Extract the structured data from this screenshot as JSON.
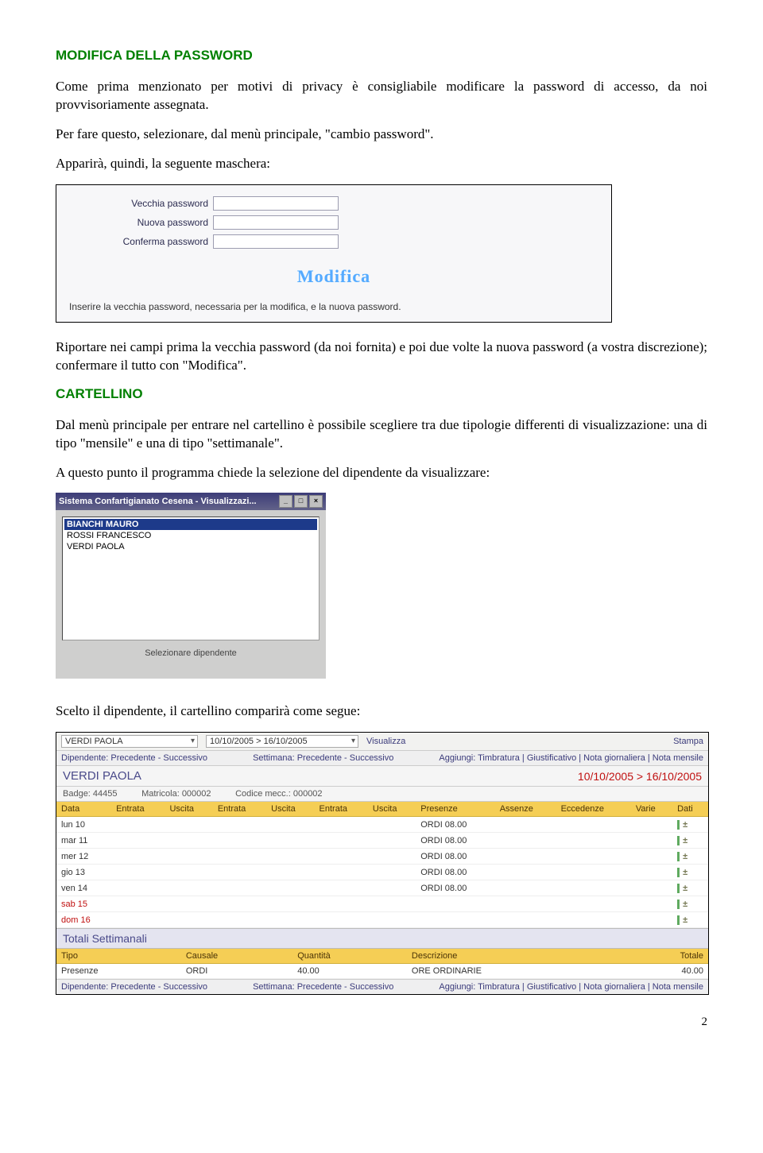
{
  "section1": {
    "title": "MODIFICA DELLA PASSWORD",
    "para1": "Come prima menzionato per motivi di privacy è consigliabile modificare la password di accesso, da noi provvisoriamente assegnata.",
    "para2": "Per fare questo, selezionare, dal menù principale, \"cambio password\".",
    "para3": "Apparirà, quindi, la seguente maschera:"
  },
  "pwdform": {
    "labels": {
      "old": "Vecchia password",
      "new": "Nuova password",
      "confirm": "Conferma password"
    },
    "button": "Modifica",
    "note": "Inserire la vecchia password, necessaria per la modifica, e la nuova password."
  },
  "afterPwd": "Riportare nei campi prima la vecchia password (da noi fornita) e poi due volte la nuova password (a vostra discrezione); confermare il tutto con \"Modifica\".",
  "section2": {
    "title": "CARTELLINO",
    "para1": "Dal menù principale per entrare nel cartellino è possibile scegliere tra due tipologie differenti di visualizzazione: una di tipo \"mensile\" e una di tipo \"settimanale\".",
    "para2": "A questo punto il programma chiede la selezione del dipendente da visualizzare:"
  },
  "empWindow": {
    "title": "Sistema Confartigianato Cesena - Visualizzazi...",
    "items": [
      "BIANCHI MAURO",
      "ROSSI FRANCESCO",
      "VERDI PAOLA"
    ],
    "footer": "Selezionare dipendente"
  },
  "afterEmp": "Scelto il dipendente, il cartellino comparirà come segue:",
  "cartellino": {
    "topEmployee": "VERDI PAOLA",
    "topRange": "10/10/2005 > 16/10/2005",
    "topLinkVis": "Visualizza",
    "topLinkPrint": "Stampa",
    "subLeft": "Dipendente: Precedente - Successivo",
    "subMid": "Settimana: Precedente - Successivo",
    "subRight": "Aggiungi: Timbratura | Giustificativo | Nota giornaliera | Nota mensile",
    "nameBar": "VERDI PAOLA",
    "rangeBar": "10/10/2005 > 16/10/2005",
    "metaBadge": "Badge: 44455",
    "metaMatricola": "Matricola: 000002",
    "metaCodice": "Codice mecc.: 000002",
    "headers": [
      "Data",
      "Entrata",
      "Uscita",
      "Entrata",
      "Uscita",
      "Entrata",
      "Uscita",
      "Presenze",
      "Assenze",
      "Eccedenze",
      "Varie",
      "Dati"
    ],
    "rows": [
      {
        "data": "lun 10",
        "presenze": "ORDI 08.00",
        "class": ""
      },
      {
        "data": "mar 11",
        "presenze": "ORDI 08.00",
        "class": ""
      },
      {
        "data": "mer 12",
        "presenze": "ORDI 08.00",
        "class": ""
      },
      {
        "data": "gio 13",
        "presenze": "ORDI 08.00",
        "class": ""
      },
      {
        "data": "ven 14",
        "presenze": "ORDI 08.00",
        "class": ""
      },
      {
        "data": "sab 15",
        "presenze": "",
        "class": "sab"
      },
      {
        "data": "dom 16",
        "presenze": "",
        "class": "dom"
      }
    ],
    "totaliTitle": "Totali Settimanali",
    "totalsHeaders": [
      "Tipo",
      "Causale",
      "Quantità",
      "Descrizione",
      "Totale"
    ],
    "totalsRow": {
      "tipo": "Presenze",
      "causale": "ORDI",
      "qta": "40.00",
      "desc": "ORE ORDINARIE",
      "totale": "40.00"
    }
  },
  "pageNumber": "2"
}
